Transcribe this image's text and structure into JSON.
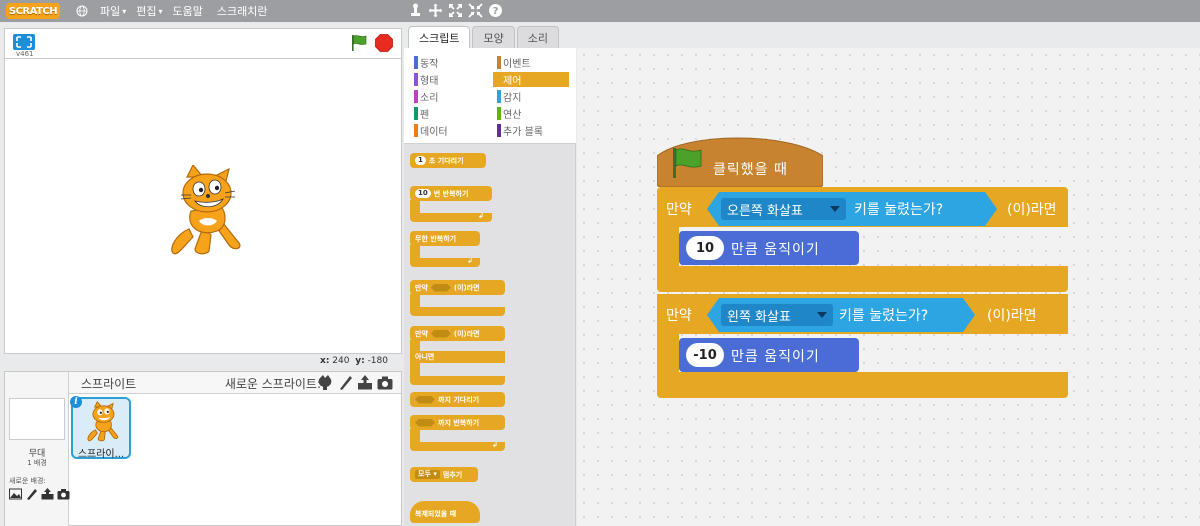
{
  "menubar": {
    "logo": "SCRATCH",
    "menus": [
      {
        "label": "파일",
        "caret": "▾"
      },
      {
        "label": "편집",
        "caret": "▾"
      },
      {
        "label": "도움말",
        "caret": ""
      },
      {
        "label": "스크래치란",
        "caret": ""
      }
    ],
    "tools": [
      "stamp-icon",
      "cut-icon",
      "grow-icon",
      "shrink-icon",
      "help-icon"
    ]
  },
  "stage": {
    "version": "v461",
    "coords": {
      "x_label": "x:",
      "x": "240",
      "y_label": "y:",
      "y": "-180"
    }
  },
  "sprites_panel": {
    "stage_label": "무대",
    "backdrop_count": "1 배경",
    "new_backdrop_label": "새로운 배경:",
    "title": "스프라이트",
    "new_sprite_label": "새로운 스프라이트:",
    "sprite_name": "스프라이...",
    "info_icon": "i"
  },
  "tabs": [
    {
      "label": "스크립트",
      "active": true
    },
    {
      "label": "모양",
      "active": false
    },
    {
      "label": "소리",
      "active": false
    }
  ],
  "categories": [
    {
      "label": "동작",
      "color": "#4a6cd4"
    },
    {
      "label": "이벤트",
      "color": "#c88330"
    },
    {
      "label": "형태",
      "color": "#8a55d7"
    },
    {
      "label": "제어",
      "color": "#e6a822"
    },
    {
      "label": "소리",
      "color": "#bb42c3"
    },
    {
      "label": "감지",
      "color": "#2ca5e2"
    },
    {
      "label": "펜",
      "color": "#0e9a6c"
    },
    {
      "label": "연산",
      "color": "#5cb712"
    },
    {
      "label": "데이터",
      "color": "#ee7d16"
    },
    {
      "label": "추가 블록",
      "color": "#632d99"
    }
  ],
  "palette_blocks": {
    "wait": {
      "num": "1",
      "text": "초 기다리기"
    },
    "repeat": {
      "num": "10",
      "text": "번 반복하기"
    },
    "forever": {
      "text": "무한 반복하기"
    },
    "if": {
      "pre": "만약",
      "post": "(이)라면"
    },
    "ifelse": {
      "pre": "만약",
      "post": "(이)라면",
      "else": "아니면"
    },
    "wait_until": {
      "text": "까지 기다리기"
    },
    "repeat_until": {
      "text": "까지 반복하기"
    },
    "stop": {
      "option": "모두",
      "text": "멈추기"
    },
    "clone_hat": {
      "text": "복제되었을 때"
    },
    "loop_arrow": "↲"
  },
  "script": {
    "hat_label": "클릭했을 때",
    "if1": {
      "pre": "만약",
      "key": "오른쪽 화살표",
      "mid": "키를 눌렸는가?",
      "post": "(이)라면",
      "steps": "10",
      "move_label": "만큼 움직이기"
    },
    "if2": {
      "pre": "만약",
      "key": "왼쪽 화살표",
      "mid": "키를 눌렸는가?",
      "post": "(이)라면",
      "steps": "-10",
      "move_label": "만큼 움직이기"
    }
  }
}
